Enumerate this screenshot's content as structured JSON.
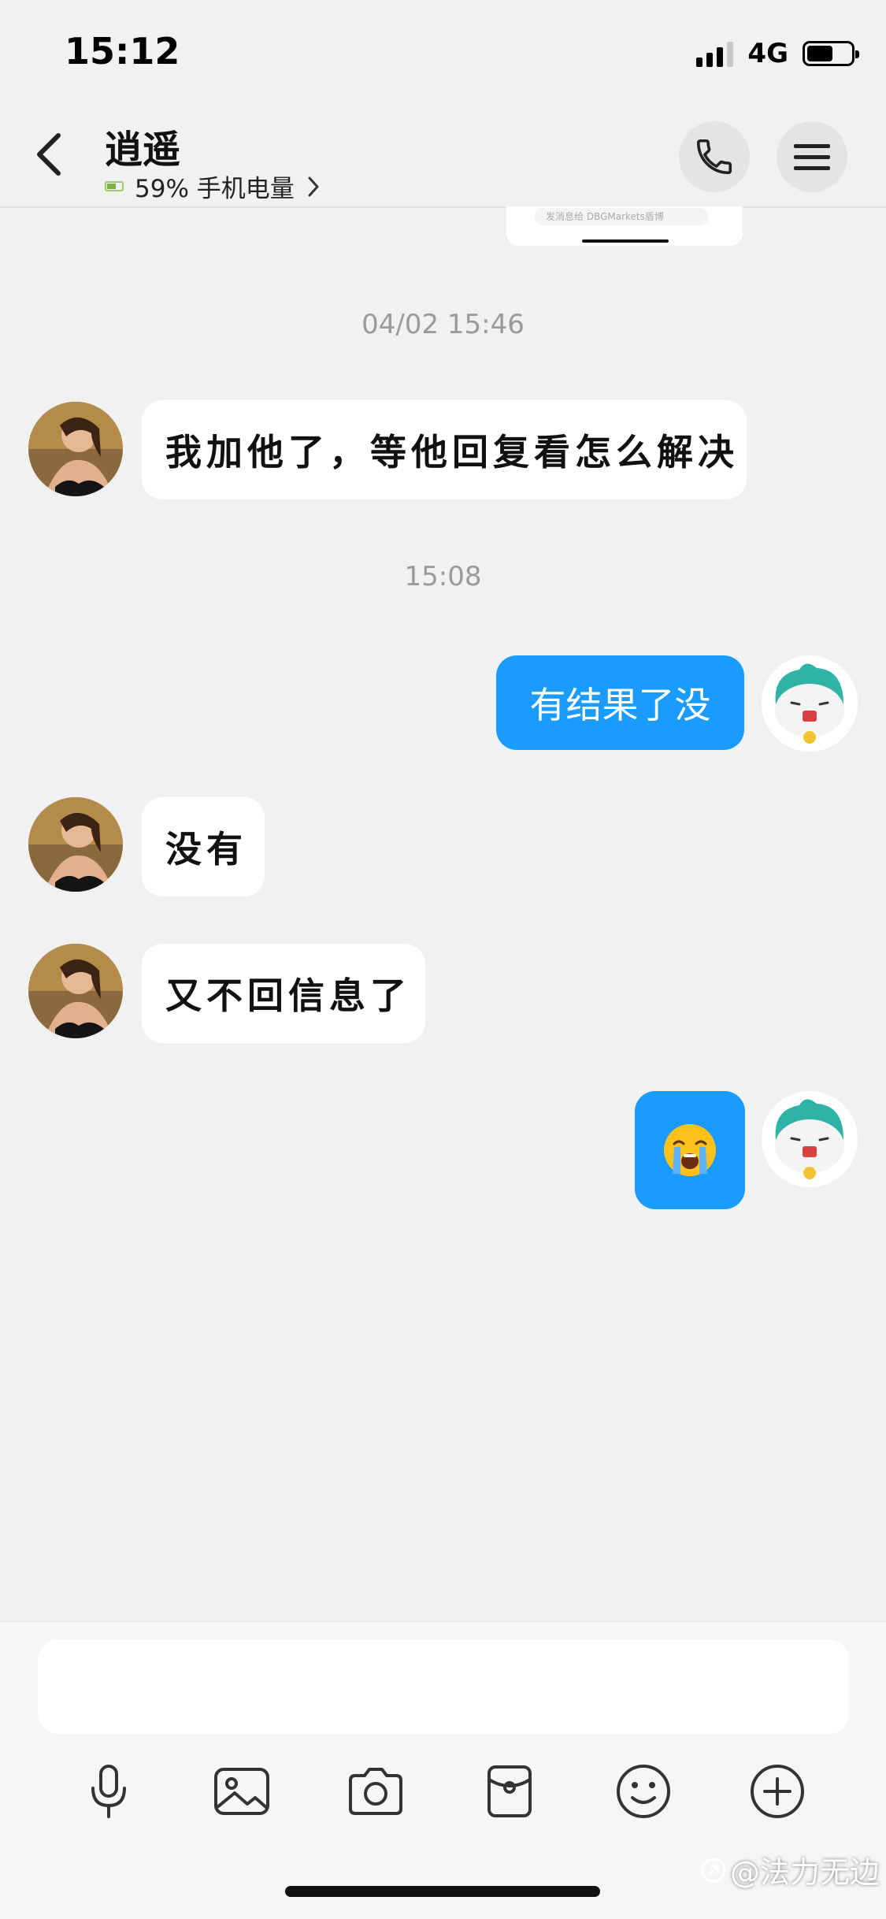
{
  "status_bar": {
    "time": "15:12",
    "network": "4G",
    "battery_level": 0.6
  },
  "header": {
    "contact_name": "逍遥",
    "battery_status": "59% 手机电量",
    "back_icon": "chevron-left-icon",
    "call_icon": "phone-icon",
    "menu_icon": "hamburger-menu-icon"
  },
  "previous_card": {
    "text": "发消息给 DBGMarkets盾博"
  },
  "timestamps": [
    "04/02 15:46",
    "15:08"
  ],
  "messages": [
    {
      "side": "incoming",
      "text": "我加他了，等他回复看怎么解决"
    },
    {
      "side": "outgoing",
      "text": "有结果了没"
    },
    {
      "side": "incoming",
      "text": "没有"
    },
    {
      "side": "incoming",
      "text": "又不回信息了"
    },
    {
      "side": "outgoing",
      "text": "😭",
      "emoji_name": "loudly-crying-face"
    }
  ],
  "input": {
    "placeholder": "",
    "value": ""
  },
  "toolbar": [
    "microphone-icon",
    "image-icon",
    "camera-icon",
    "red-packet-icon",
    "emoji-icon",
    "plus-icon"
  ],
  "watermark": "@法力无边",
  "colors": {
    "outgoing_bubble": "#1a9bff",
    "incoming_bubble": "#ffffff",
    "background": "#f1f1f1"
  }
}
